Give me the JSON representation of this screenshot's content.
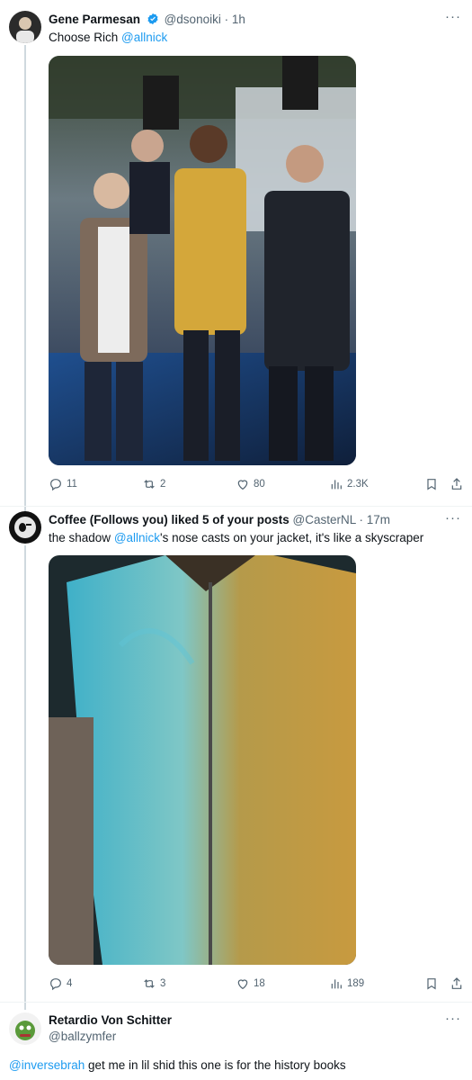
{
  "posts": [
    {
      "name": "Gene Parmesan",
      "handle": "@dsonoiki",
      "time": "· 1h",
      "text_prefix": "Choose Rich ",
      "mention": "@allnick",
      "stats": {
        "replies": "11",
        "reposts": "2",
        "likes": "80",
        "views": "2.3K"
      }
    },
    {
      "name": "Coffee (Follows you) liked 5 of your posts",
      "handle": "@CasterNL",
      "time": "· 17m",
      "text_prefix": "the shadow ",
      "mention": "@allnick",
      "text_suffix": "'s nose casts on your jacket, it's like a skyscraper",
      "stats": {
        "replies": "4",
        "reposts": "3",
        "likes": "18",
        "views": "189"
      }
    },
    {
      "name": "Retardio Von Schitter",
      "handle": "@ballzymfer",
      "mention": "@inversebrah",
      "text_suffix": " get me in lil shid this one is for the history books"
    }
  ],
  "more_label": "···",
  "colors": {
    "accent": "#1d9bf0",
    "text": "#0f1419",
    "muted": "#536471",
    "line": "#cfd9de"
  },
  "icons": [
    "verified-badge-icon",
    "more-icon",
    "reply-icon",
    "repost-icon",
    "like-icon",
    "views-icon",
    "bookmark-icon",
    "share-icon"
  ]
}
